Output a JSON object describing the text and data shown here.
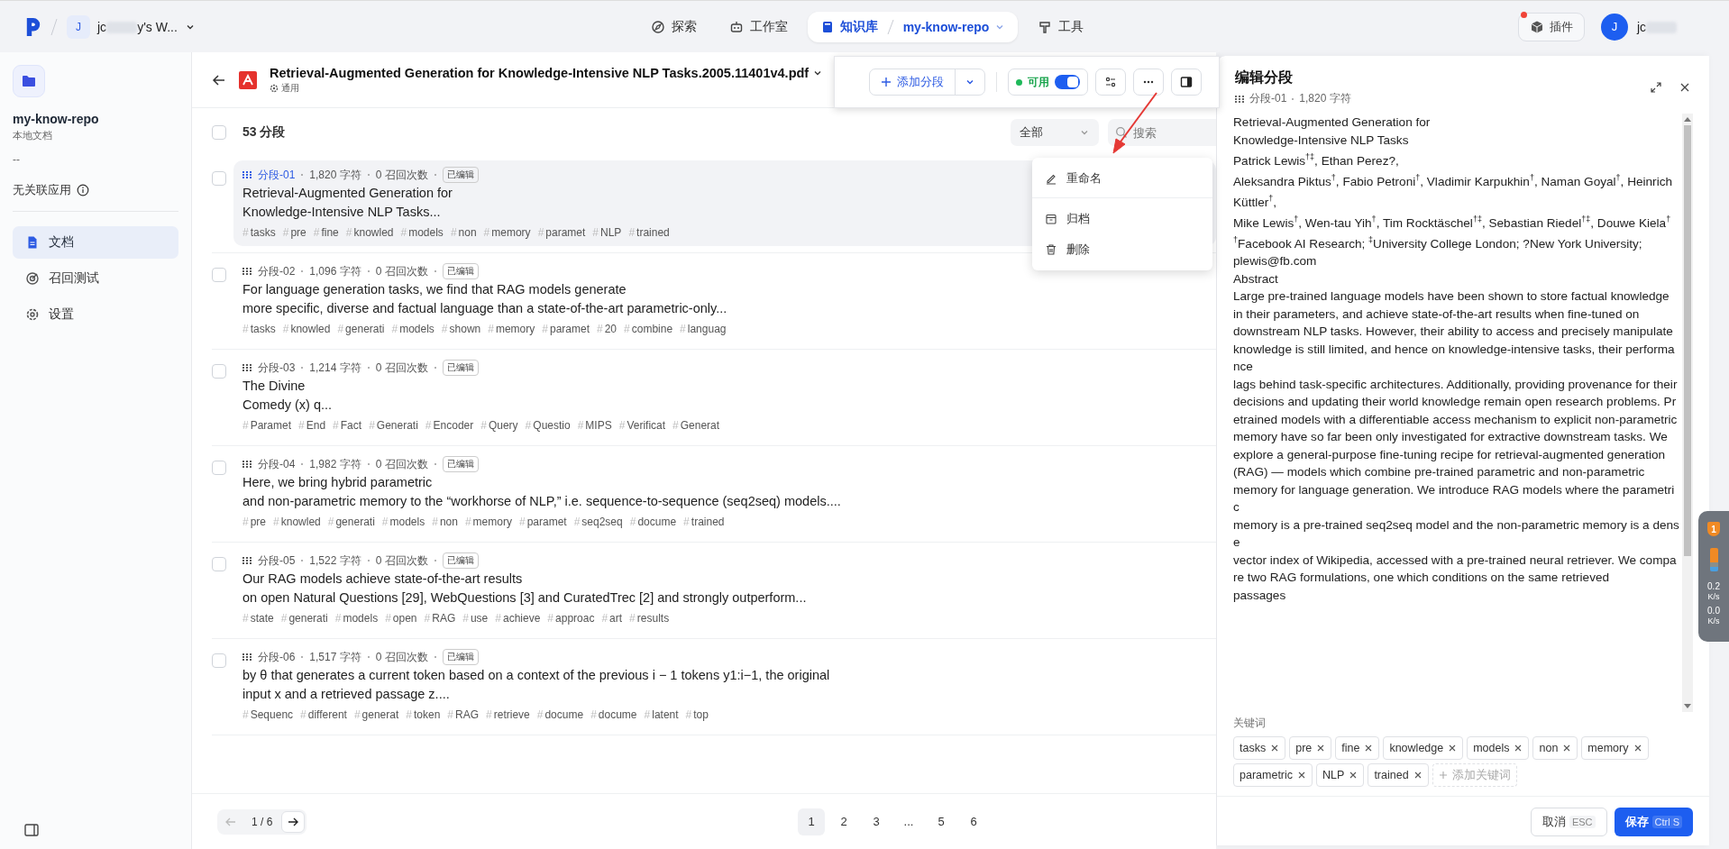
{
  "topbar": {
    "workspace": {
      "avatar": "J",
      "name": "jc",
      "name_tail": "y's W..."
    },
    "nav": [
      {
        "label": "探索",
        "selected": false
      },
      {
        "label": "工作室",
        "selected": false
      },
      {
        "label": "知识库",
        "selected": true,
        "crumb": "my-know-repo"
      },
      {
        "label": "工具",
        "selected": false
      }
    ],
    "plugin_button": {
      "label": "插件",
      "notify": true
    },
    "user": {
      "avatar": "J",
      "name": "jc"
    }
  },
  "sidebar": {
    "repo_name": "my-know-repo",
    "repo_type": "本地文档",
    "description": "--",
    "linked_apps": "无关联应用",
    "items": [
      {
        "label": "文档",
        "selected": true
      },
      {
        "label": "召回测试",
        "selected": false
      },
      {
        "label": "设置",
        "selected": false
      }
    ]
  },
  "document": {
    "title": "Retrieval-Augmented Generation for Knowledge-Intensive NLP Tasks.2005.11401v4.pdf",
    "mode": "通用"
  },
  "toolbar": {
    "add_button": "添加分段",
    "status": {
      "label": "可用",
      "on": true
    }
  },
  "menu": [
    {
      "label": "重命名"
    },
    {
      "label": "归档"
    },
    {
      "label": "删除"
    }
  ],
  "list_header": {
    "checked": false,
    "count": "53 分段",
    "filter": "全部",
    "search_placeholder": "搜索"
  },
  "tag_mark": "#",
  "segments": [
    {
      "checked": false,
      "selected": true,
      "label": "分段-01",
      "chars": "1,820 字符",
      "recalls": "0 召回次数",
      "badge": "已编辑",
      "lines": [
        "Retrieval-Augmented Generation for",
        "Knowledge-Intensive NLP Tasks..."
      ],
      "tags": [
        "tasks",
        "pre",
        "fine",
        "knowled",
        "models",
        "non",
        "memory",
        "paramet",
        "NLP",
        "trained"
      ]
    },
    {
      "checked": false,
      "selected": false,
      "label": "分段-02",
      "chars": "1,096 字符",
      "recalls": "0 召回次数",
      "badge": "已编辑",
      "lines": [
        "For language generation tasks, we find that RAG models generate",
        "more specific, diverse and factual language than a state-of-the-art parametric-only..."
      ],
      "tags": [
        "tasks",
        "knowled",
        "generati",
        "models",
        "shown",
        "memory",
        "paramet",
        "20",
        "combine",
        "languag"
      ]
    },
    {
      "checked": false,
      "selected": false,
      "label": "分段-03",
      "chars": "1,214 字符",
      "recalls": "0 召回次数",
      "badge": "已编辑",
      "lines": [
        "The Divine",
        "Comedy (x) q..."
      ],
      "tags": [
        "Paramet",
        "End",
        "Fact",
        "Generati",
        "Encoder",
        "Query",
        "Questio",
        "MIPS",
        "Verificat",
        "Generat"
      ]
    },
    {
      "checked": false,
      "selected": false,
      "label": "分段-04",
      "chars": "1,982 字符",
      "recalls": "0 召回次数",
      "badge": "已编辑",
      "lines": [
        "Here, we bring hybrid parametric",
        "and non-parametric memory to the “workhorse of NLP,” i.e. sequence-to-sequence (seq2seq) models...."
      ],
      "tags": [
        "pre",
        "knowled",
        "generati",
        "models",
        "non",
        "memory",
        "paramet",
        "seq2seq",
        "docume",
        "trained"
      ]
    },
    {
      "checked": false,
      "selected": false,
      "label": "分段-05",
      "chars": "1,522 字符",
      "recalls": "0 召回次数",
      "badge": "已编辑",
      "lines": [
        "Our RAG models achieve state-of-the-art results",
        "on open Natural Questions [29], WebQuestions [3] and CuratedTrec [2] and strongly outperform..."
      ],
      "tags": [
        "state",
        "generati",
        "models",
        "open",
        "RAG",
        "use",
        "achieve",
        "approac",
        "art",
        "results"
      ]
    },
    {
      "checked": false,
      "selected": false,
      "label": "分段-06",
      "chars": "1,517 字符",
      "recalls": "0 召回次数",
      "badge": "已编辑",
      "lines": [
        "by θ that generates a current token based on a context of the previous i − 1 tokens y1:i−1, the original",
        "input x and a retrieved passage z...."
      ],
      "tags": [
        "Sequenc",
        "different",
        "generat",
        "token",
        "RAG",
        "retrieve",
        "docume",
        "docume",
        "latent",
        "top"
      ]
    }
  ],
  "pagination": {
    "page_of": "1 / 6",
    "pages": [
      {
        "label": "1",
        "selected": true
      },
      {
        "label": "2",
        "selected": false
      },
      {
        "label": "3",
        "selected": false
      },
      {
        "label": "...",
        "selected": false
      },
      {
        "label": "5",
        "selected": false
      },
      {
        "label": "6",
        "selected": false
      }
    ]
  },
  "editor": {
    "title": "编辑分段",
    "segment": "分段-01",
    "chars": "1,820 字符",
    "lines": [
      "Retrieval-Augmented Generation for",
      "Knowledge-Intensive NLP Tasks",
      "Patrick Lewis$^{†‡}$, Ethan Perez?,",
      "Aleksandra Piktus$^{†}$, Fabio Petroni$^{†}$, Vladimir Karpukhin$^{†}$, Naman Goyal$^{†}$, Heinrich Küttler$^{†}$,",
      "Mike Lewis$^{†}$, Wen-tau Yih$^{†}$, Tim Rocktäschel$^{†‡}$, Sebastian Riedel$^{†‡}$, Douwe Kiela$^{†}$",
      "$^{†}$Facebook AI Research; $^{‡}$University College London; ?New York University;",
      "plewis@fb.com",
      "Abstract",
      "Large pre-trained language models have been shown to store factual knowledge",
      "in their parameters, and achieve state-of-the-art results when fine-tuned on",
      "downstream NLP tasks. However, their ability to access and precisely manipulate knowledge is still limited, and hence on knowledge-intensive tasks, their performance",
      "lags behind task-specific architectures. Additionally, providing provenance for their",
      "decisions and updating their world knowledge remain open research problems. Pretrained models with a differentiable access mechanism to explicit non-parametric",
      "memory have so far been only investigated for extractive downstream tasks. We",
      "explore a general-purpose fine-tuning recipe for retrieval-augmented generation",
      "(RAG) — models which combine pre-trained parametric and non-parametric",
      "memory for language generation. We introduce RAG models where the parametric",
      "memory is a pre-trained seq2seq model and the non-parametric memory is a dense",
      "vector index of Wikipedia, accessed with a pre-trained neural retriever. We compare two RAG formulations, one which conditions on the same retrieved",
      "passages"
    ],
    "keywords_label": "关键词",
    "keywords": [
      "tasks",
      "pre",
      "fine",
      "knowledge",
      "models",
      "non",
      "memory",
      "parametric",
      "NLP",
      "trained"
    ],
    "add_keyword": "添加关键词",
    "cancel": {
      "label": "取消",
      "key": "ESC"
    },
    "save": {
      "label": "保存",
      "key": "Ctrl S"
    }
  },
  "speed_widget": {
    "badge": "1",
    "up": {
      "value": "0.2",
      "unit": "K/s"
    },
    "down": {
      "value": "0.0",
      "unit": "K/s"
    }
  }
}
